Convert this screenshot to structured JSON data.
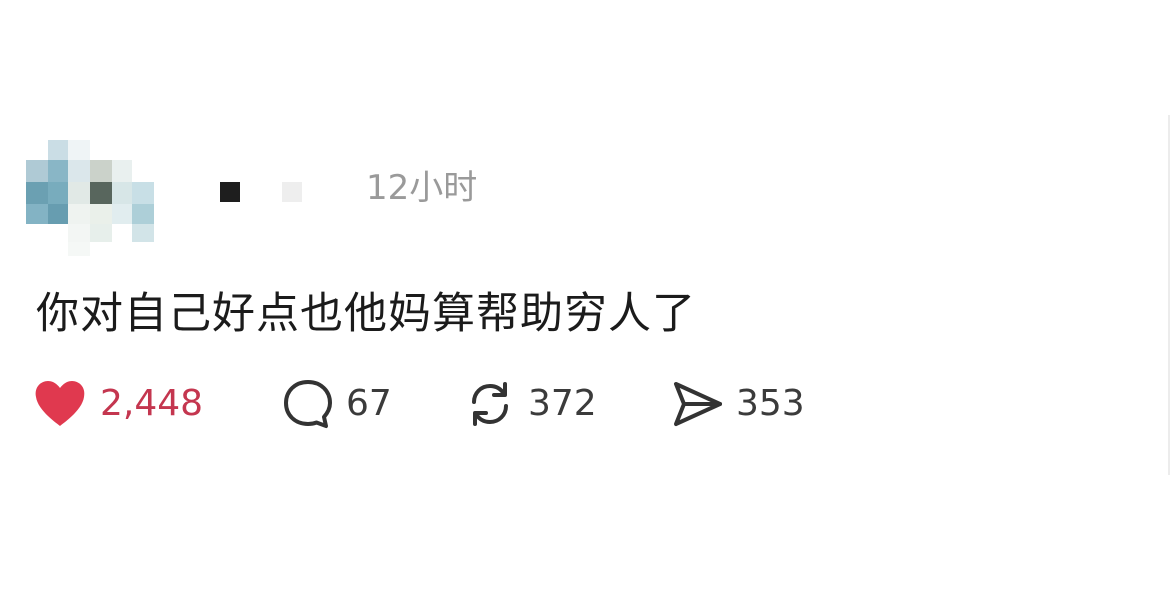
{
  "post": {
    "author": {
      "avatar_censored": true,
      "name_censored": true
    },
    "timestamp": "12小时",
    "text": "你对自己好点也他妈算帮助穷人了",
    "actions": {
      "like": {
        "icon": "heart-icon",
        "count": "2,448",
        "color": "#e0394f"
      },
      "comment": {
        "icon": "comment-bubble-icon",
        "count": "67"
      },
      "repost": {
        "icon": "repost-icon",
        "count": "372"
      },
      "share": {
        "icon": "send-icon",
        "count": "353"
      }
    }
  }
}
